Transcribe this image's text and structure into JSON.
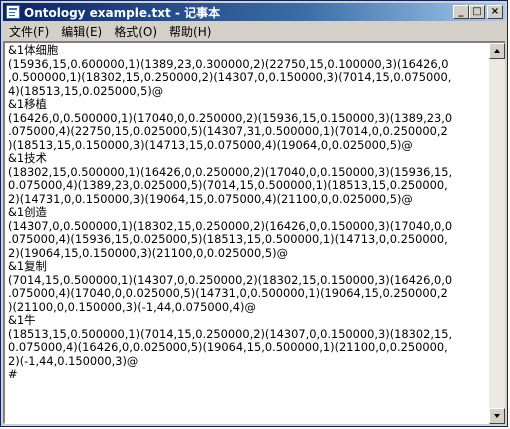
{
  "window": {
    "title": "Ontology example.txt - 记事本",
    "minimize_label": "_",
    "maximize_label": "□",
    "close_label": "×"
  },
  "menu": {
    "file": "文件(F)",
    "edit": "编辑(E)",
    "format": "格式(O)",
    "help": "帮助(H)"
  },
  "document": {
    "lines": [
      "&1体细胞",
      "(15936,15,0.600000,1)(1389,23,0.300000,2)(22750,15,0.100000,3)(16426,0",
      ",0.500000,1)(18302,15,0.250000,2)(14307,0,0.150000,3)(7014,15,0.075000,",
      "4)(18513,15,0.025000,5)@",
      "&1移植",
      "(16426,0,0.500000,1)(17040,0,0.250000,2)(15936,15,0.150000,3)(1389,23,0",
      ".075000,4)(22750,15,0.025000,5)(14307,31,0.500000,1)(7014,0,0.250000,2",
      ")(18513,15,0.150000,3)(14713,15,0.075000,4)(19064,0,0.025000,5)@",
      "&1技术",
      "(18302,15,0.500000,1)(16426,0,0.250000,2)(17040,0,0.150000,3)(15936,15,",
      "0.075000,4)(1389,23,0.025000,5)(7014,15,0.500000,1)(18513,15,0.250000,",
      "2)(14731,0,0.150000,3)(19064,15,0.075000,4)(21100,0,0.025000,5)@",
      "&1创造",
      "(14307,0,0.500000,1)(18302,15,0.250000,2)(16426,0,0.150000,3)(17040,0,0",
      ".075000,4)(15936,15,0.025000,5)(18513,15,0.500000,1)(14713,0,0.250000,",
      "2)(19064,15,0.150000,3)(21100,0,0.025000,5)@",
      "&1复制",
      "(7014,15,0.500000,1)(14307,0,0.250000,2)(18302,15,0.150000,3)(16426,0,0",
      ".075000,4)(17040,0,0.025000,5)(14731,0,0.500000,1)(19064,15,0.250000,2",
      ")(21100,0,0.150000,3)(-1,44,0.075000,4)@",
      "&1牛",
      "(18513,15,0.500000,1)(7014,15,0.250000,2)(14307,0,0.150000,3)(18302,15,",
      "0.075000,4)(16426,0,0.025000,5)(19064,15,0.500000,1)(21100,0,0.250000,",
      "2)(-1,44,0.150000,3)@",
      "#"
    ]
  }
}
